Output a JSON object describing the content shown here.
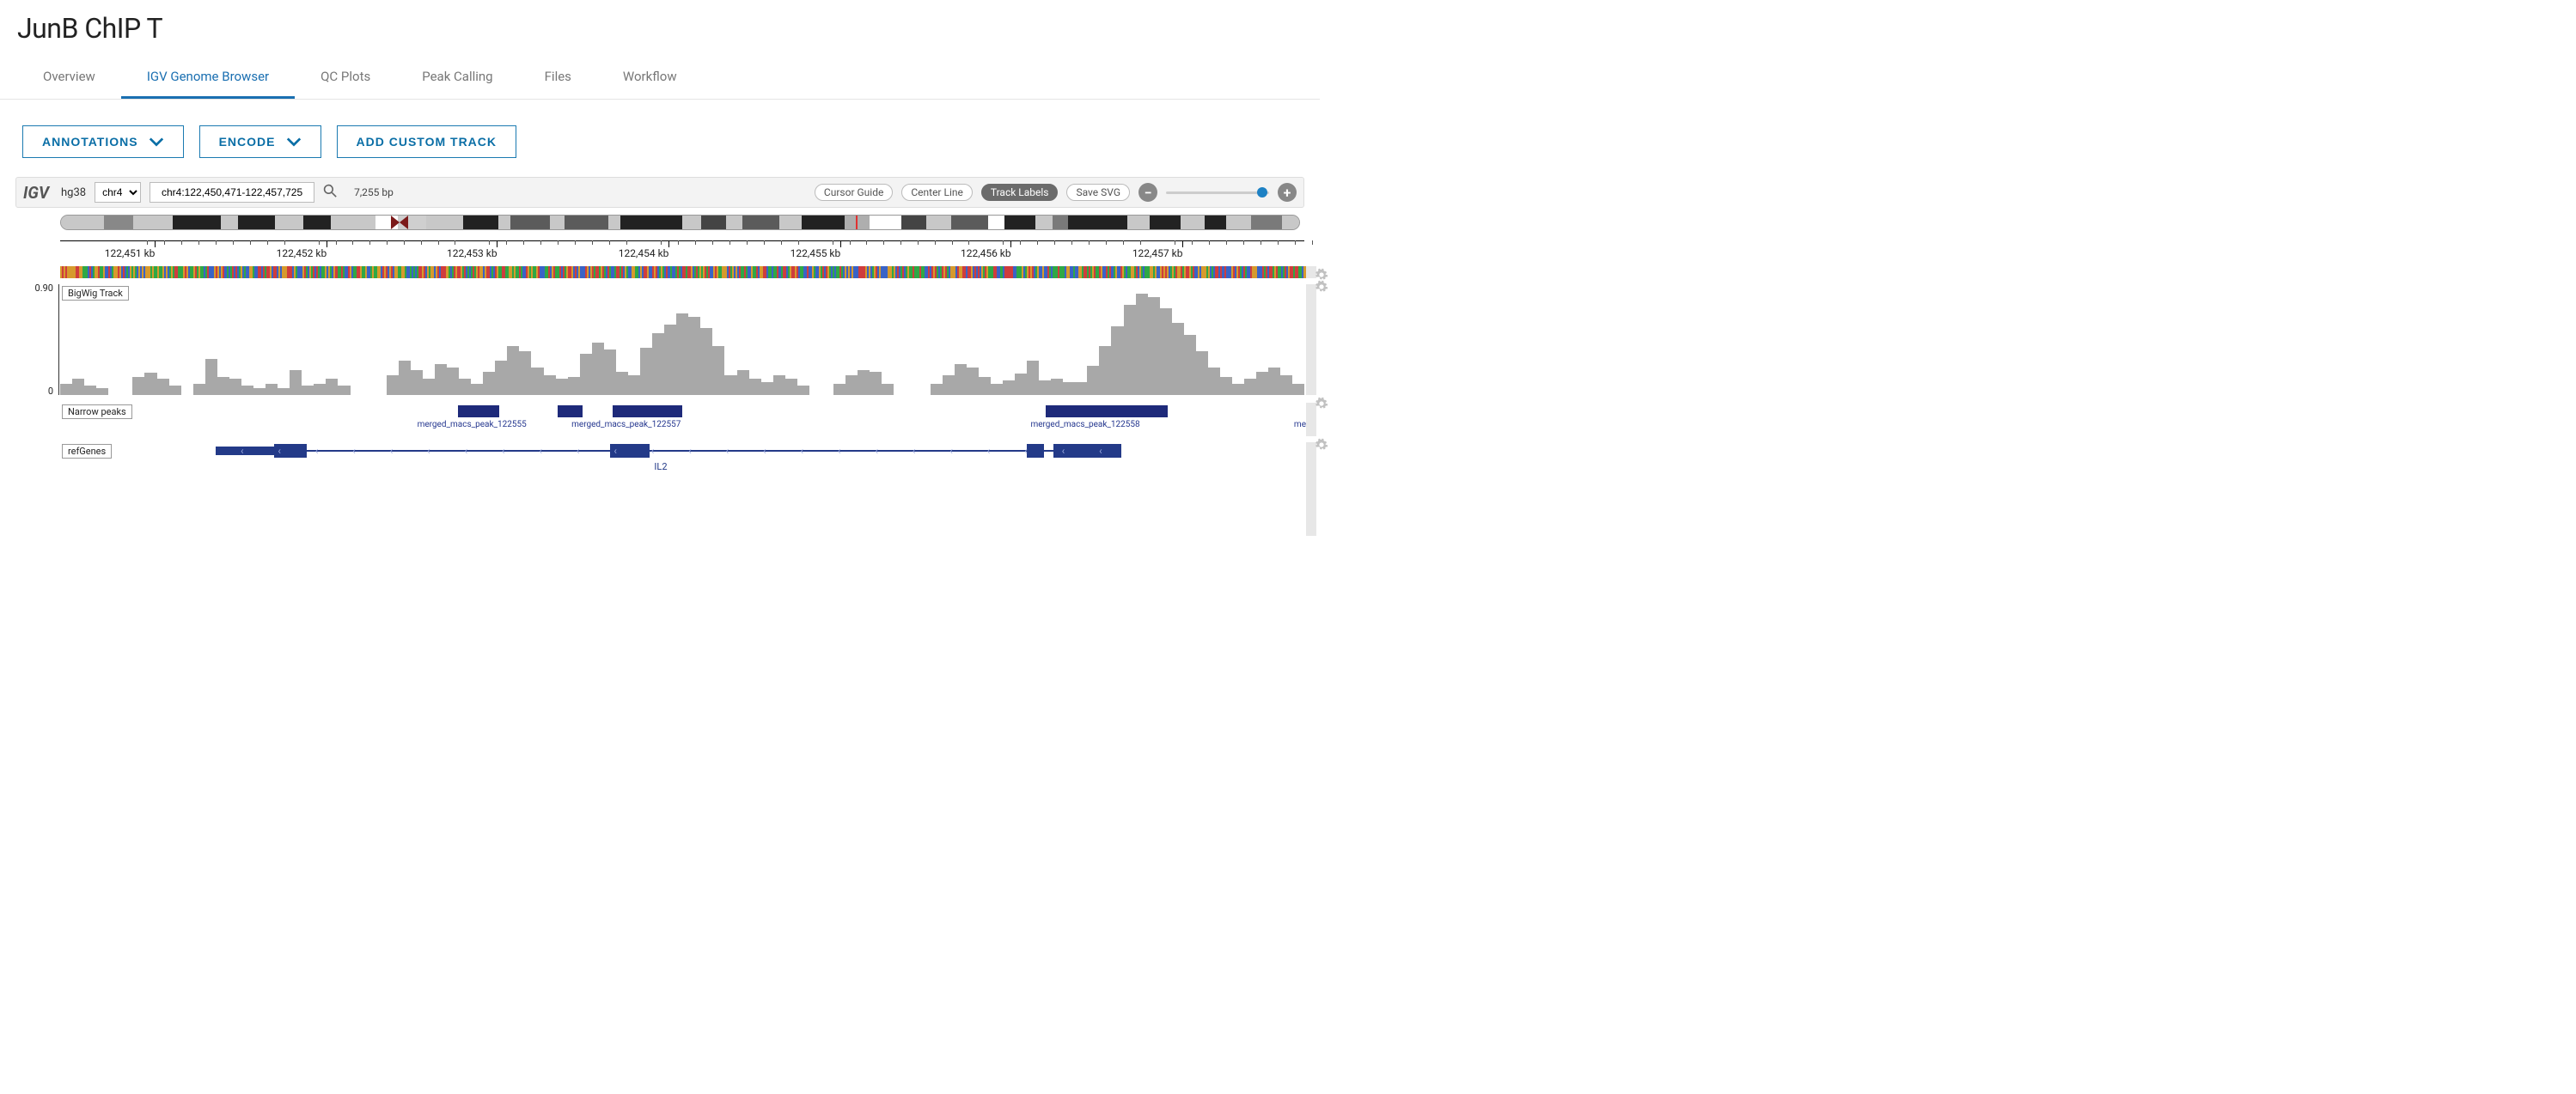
{
  "title": "JunB ChIP T",
  "tabs": [
    "Overview",
    "IGV Genome Browser",
    "QC Plots",
    "Peak Calling",
    "Files",
    "Workflow"
  ],
  "activeTab": 1,
  "buttons": {
    "annotations": "ANNOTATIONS",
    "encode": "ENCODE",
    "add": "ADD CUSTOM TRACK"
  },
  "toolbar": {
    "logo": "IGV",
    "genome": "hg38",
    "chrSelect": "chr4",
    "locus": "chr4:122,450,471-122,457,725",
    "span": "7,255 bp",
    "cursorGuide": "Cursor Guide",
    "centerLine": "Center Line",
    "trackLabels": "Track Labels",
    "saveSvg": "Save SVG"
  },
  "ideogramBands": [
    {
      "x": 0,
      "w": 3.5,
      "c": "#c8c8c8"
    },
    {
      "x": 3.5,
      "w": 2.3,
      "c": "#888"
    },
    {
      "x": 5.8,
      "w": 3.2,
      "c": "#c8c8c8"
    },
    {
      "x": 9.0,
      "w": 3.9,
      "c": "#222"
    },
    {
      "x": 12.9,
      "w": 1.4,
      "c": "#c8c8c8"
    },
    {
      "x": 14.3,
      "w": 3.0,
      "c": "#222"
    },
    {
      "x": 17.3,
      "w": 2.3,
      "c": "#c8c8c8"
    },
    {
      "x": 19.6,
      "w": 2.2,
      "c": "#222"
    },
    {
      "x": 21.8,
      "w": 3.6,
      "c": "#c8c8c8"
    },
    {
      "x": 25.4,
      "w": 1.8,
      "c": "#ffffff"
    },
    {
      "x": 29.5,
      "w": 3.0,
      "c": "#c8c8c8"
    },
    {
      "x": 32.5,
      "w": 2.8,
      "c": "#222"
    },
    {
      "x": 35.3,
      "w": 1.0,
      "c": "#c8c8c8"
    },
    {
      "x": 36.3,
      "w": 3.2,
      "c": "#5b5b5b"
    },
    {
      "x": 39.5,
      "w": 1.2,
      "c": "#c8c8c8"
    },
    {
      "x": 40.7,
      "w": 3.5,
      "c": "#5b5b5b"
    },
    {
      "x": 44.2,
      "w": 1.0,
      "c": "#c8c8c8"
    },
    {
      "x": 45.2,
      "w": 5.0,
      "c": "#222"
    },
    {
      "x": 50.2,
      "w": 1.5,
      "c": "#c8c8c8"
    },
    {
      "x": 51.7,
      "w": 2.0,
      "c": "#444"
    },
    {
      "x": 53.7,
      "w": 1.3,
      "c": "#c8c8c8"
    },
    {
      "x": 55.0,
      "w": 3.0,
      "c": "#5b5b5b"
    },
    {
      "x": 58.0,
      "w": 1.8,
      "c": "#c8c8c8"
    },
    {
      "x": 59.8,
      "w": 3.5,
      "c": "#222"
    },
    {
      "x": 63.3,
      "w": 2.0,
      "c": "#aeaeae"
    },
    {
      "x": 65.3,
      "w": 2.6,
      "c": "#ffffff"
    },
    {
      "x": 67.9,
      "w": 2.0,
      "c": "#444"
    },
    {
      "x": 69.9,
      "w": 2.0,
      "c": "#c8c8c8"
    },
    {
      "x": 71.9,
      "w": 3.0,
      "c": "#5b5b5b"
    },
    {
      "x": 74.9,
      "w": 1.3,
      "c": "#ffffff"
    },
    {
      "x": 76.2,
      "w": 2.5,
      "c": "#222"
    },
    {
      "x": 78.7,
      "w": 1.4,
      "c": "#c8c8c8"
    },
    {
      "x": 80.1,
      "w": 1.2,
      "c": "#7a7a7a"
    },
    {
      "x": 81.3,
      "w": 4.8,
      "c": "#222"
    },
    {
      "x": 86.1,
      "w": 1.8,
      "c": "#c8c8c8"
    },
    {
      "x": 87.9,
      "w": 2.5,
      "c": "#222"
    },
    {
      "x": 90.4,
      "w": 2.0,
      "c": "#c8c8c8"
    },
    {
      "x": 92.4,
      "w": 1.7,
      "c": "#222"
    },
    {
      "x": 94.1,
      "w": 2.0,
      "c": "#c8c8c8"
    },
    {
      "x": 96.1,
      "w": 2.5,
      "c": "#7a7a7a"
    },
    {
      "x": 98.6,
      "w": 1.4,
      "c": "#c8c8c8"
    }
  ],
  "centromereX": 26.5,
  "locusMarkX": 64.2,
  "rulerTicks": [
    {
      "x": 5.6,
      "label": "122,451 kb"
    },
    {
      "x": 19.4,
      "label": "122,452 kb"
    },
    {
      "x": 33.1,
      "label": "122,453 kb"
    },
    {
      "x": 46.9,
      "label": "122,454 kb"
    },
    {
      "x": 60.7,
      "label": "122,455 kb"
    },
    {
      "x": 74.4,
      "label": "122,456 kb"
    },
    {
      "x": 88.2,
      "label": "122,457 kb"
    }
  ],
  "bigwig": {
    "label": "BigWig Track",
    "ymax": "0.90",
    "ymin": "0",
    "values": [
      12,
      18,
      10,
      8,
      0,
      0,
      20,
      25,
      18,
      10,
      0,
      12,
      40,
      20,
      18,
      10,
      8,
      12,
      8,
      28,
      10,
      12,
      18,
      10,
      0,
      0,
      0,
      22,
      38,
      28,
      18,
      34,
      30,
      18,
      12,
      26,
      38,
      54,
      48,
      30,
      22,
      18,
      20,
      46,
      58,
      50,
      26,
      22,
      52,
      68,
      78,
      90,
      86,
      74,
      54,
      22,
      28,
      18,
      14,
      22,
      18,
      10,
      0,
      0,
      12,
      22,
      28,
      26,
      12,
      0,
      0,
      0,
      12,
      22,
      34,
      30,
      20,
      12,
      16,
      24,
      38,
      16,
      18,
      14,
      14,
      32,
      54,
      76,
      100,
      112,
      108,
      96,
      80,
      66,
      48,
      30,
      20,
      12,
      18,
      26,
      30,
      22,
      12
    ]
  },
  "narrowPeaks": {
    "label": "Narrow peaks",
    "peaks": [
      {
        "x": 32.0,
        "w": 3.3,
        "label": "merged_macs_peak_122555",
        "lx": 28.7
      },
      {
        "x": 40.0,
        "w": 2.0,
        "label": "",
        "lx": 0
      },
      {
        "x": 44.4,
        "w": 5.6,
        "label": "merged_macs_peak_122557",
        "lx": 41.1
      },
      {
        "x": 79.2,
        "w": 9.8,
        "label": "merged_macs_peak_122558",
        "lx": 78.0
      }
    ],
    "trailing": "me"
  },
  "refGenes": {
    "label": "refGenes",
    "gene": {
      "name": "IL2",
      "start": 12.5,
      "end": 85.0,
      "exons": [
        {
          "x": 12.5,
          "w": 5.0
        },
        {
          "x": 17.2,
          "w": 2.6,
          "tall": true
        },
        {
          "x": 44.2,
          "w": 3.2,
          "tall": true
        },
        {
          "x": 77.7,
          "w": 1.4,
          "tall": true
        },
        {
          "x": 79.8,
          "w": 5.5,
          "tall": true
        }
      ]
    }
  }
}
